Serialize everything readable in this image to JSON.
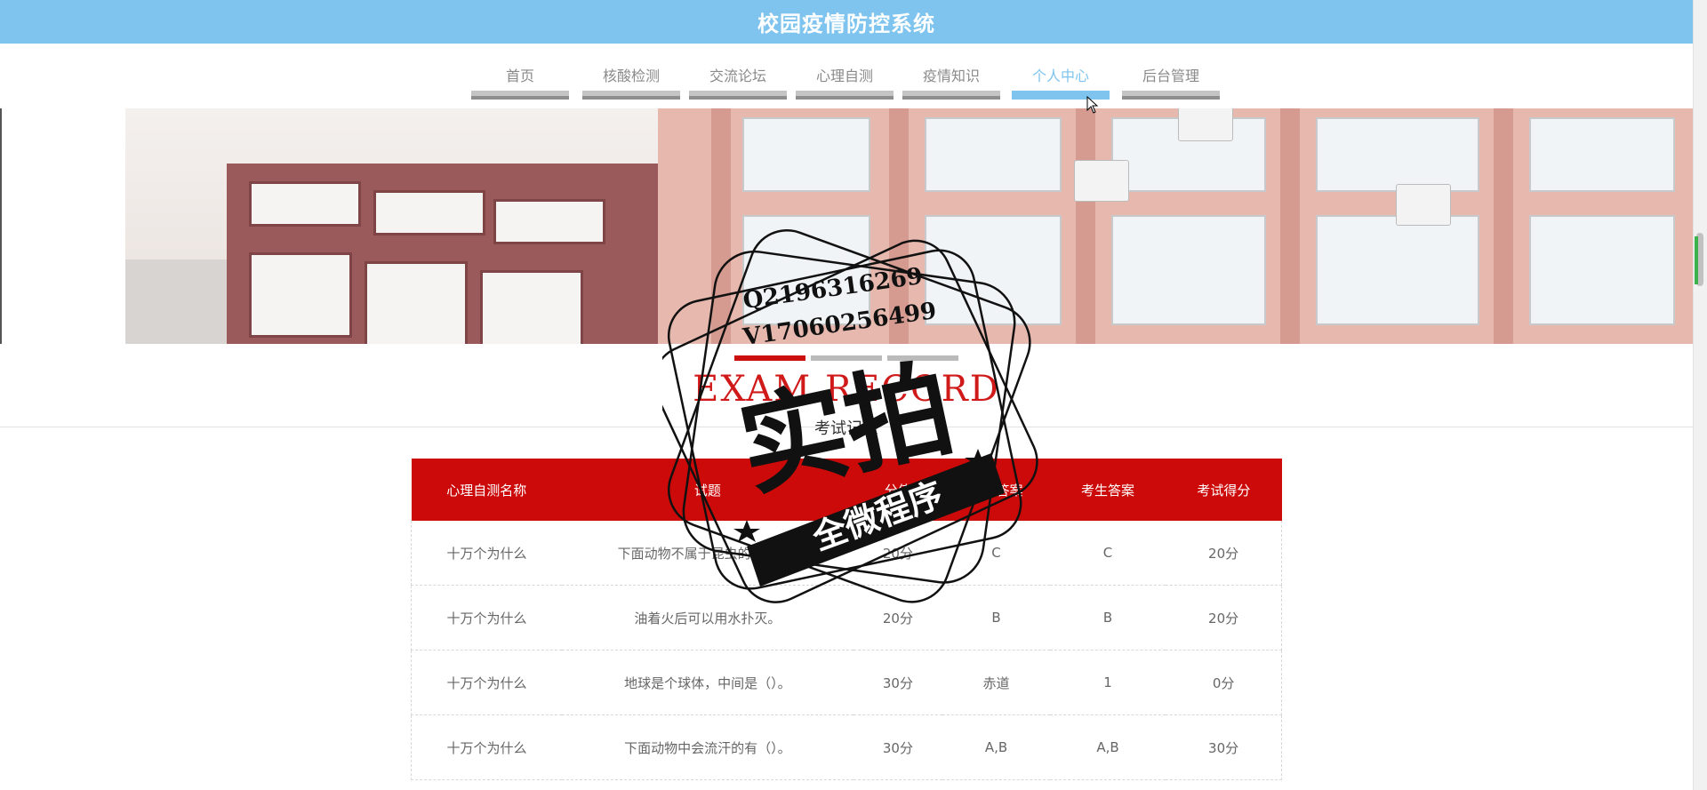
{
  "header": {
    "title": "校园疫情防控系统"
  },
  "nav": {
    "items": [
      {
        "label": "首页"
      },
      {
        "label": "核酸检测"
      },
      {
        "label": "交流论坛"
      },
      {
        "label": "心理自测"
      },
      {
        "label": "疫情知识"
      },
      {
        "label": "个人中心",
        "active": true
      },
      {
        "label": "后台管理"
      }
    ]
  },
  "section": {
    "title_en": "EXAM RECORD",
    "title_cn": "考试记录"
  },
  "table": {
    "headers": [
      "心理自测名称",
      "试题",
      "分值",
      "正确答案",
      "考生答案",
      "考试得分"
    ],
    "rows": [
      [
        "十万个为什么",
        "下面动物不属于昆虫的是（）。",
        "20分",
        "C",
        "C",
        "20分"
      ],
      [
        "十万个为什么",
        "油着火后可以用水扑灭。",
        "20分",
        "B",
        "B",
        "20分"
      ],
      [
        "十万个为什么",
        "地球是个球体，中间是（）。",
        "30分",
        "赤道",
        "1",
        "0分"
      ],
      [
        "十万个为什么",
        "下面动物中会流汗的有（）。",
        "30分",
        "A,B",
        "A,B",
        "30分"
      ]
    ]
  },
  "watermark": {
    "line1": "Q2196316269",
    "line2": "V17060256499",
    "main": "实拍",
    "ribbon": "全微程序"
  },
  "colors": {
    "header_bg": "#7ec4ee",
    "accent_red": "#cc0a0a",
    "nav_active": "#7ec4ee"
  }
}
